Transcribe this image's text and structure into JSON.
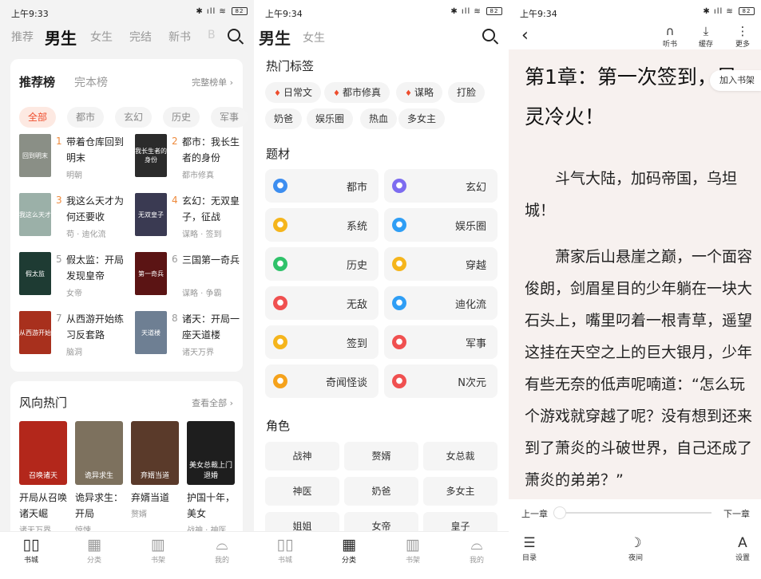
{
  "status": [
    {
      "time": "上午9:33",
      "battery": "82"
    },
    {
      "time": "上午9:34",
      "battery": "82"
    },
    {
      "time": "上午9:34",
      "battery": "82"
    }
  ],
  "p1": {
    "tabs": [
      "推荐",
      "男生",
      "女生",
      "完结",
      "新书",
      "B"
    ],
    "active_tab": "男生",
    "rank": {
      "title": "推荐榜",
      "subtitle": "完本榜",
      "more": "完整榜单 ›",
      "chips": [
        "全部",
        "都市",
        "玄幻",
        "历史",
        "军事"
      ],
      "books": [
        {
          "num": "1",
          "title": "带着仓库回到明末",
          "author": "明朝",
          "cover_text": "回到明末",
          "color": "#8a8f86"
        },
        {
          "num": "2",
          "title": "都市：我长生者的身份",
          "author": "都市修真",
          "cover_text": "我长生者的身份",
          "color": "#2b2b2b"
        },
        {
          "num": "3",
          "title": "我这么天才为何还要收",
          "author": "苟 · 迪化流",
          "cover_text": "我这么天才",
          "color": "#9bb0a8"
        },
        {
          "num": "4",
          "title": "玄幻：无双皇子，征战",
          "author": "谋略 · 签到",
          "cover_text": "无双皇子",
          "color": "#3a3a52"
        },
        {
          "num": "5",
          "title": "假太监：开局发现皇帝",
          "author": "女帝",
          "cover_text": "假太监",
          "color": "#1e3b33"
        },
        {
          "num": "6",
          "title": "三国第一奇兵",
          "author": "谋略 · 争霸",
          "cover_text": "第一奇兵",
          "color": "#5b1414"
        },
        {
          "num": "7",
          "title": "从西游开始练习反套路",
          "author": "脑洞",
          "cover_text": "从西游开始",
          "color": "#a8301d"
        },
        {
          "num": "8",
          "title": "诸天：开局一座天道楼",
          "author": "诸天万界",
          "cover_text": "天道楼",
          "color": "#6e7f93"
        }
      ]
    },
    "hot": {
      "title": "风向热门",
      "more": "查看全部 ›",
      "books": [
        {
          "title": "开局从召唤诸天崛",
          "author": "诸天万界",
          "cover_text": "召唤诸天",
          "color": "#b3271b"
        },
        {
          "title": "诡异求生：开局",
          "author": "惊悚",
          "cover_text": "诡异求生",
          "color": "#7d715e"
        },
        {
          "title": "弃婿当道",
          "author": "赘婿",
          "cover_text": "弃婿当道",
          "color": "#5a3a2a"
        },
        {
          "title": "护国十年，美女",
          "author": "战神 · 神医",
          "cover_text": "美女总裁上门退婚",
          "color": "#1e1e1e"
        }
      ]
    }
  },
  "p2": {
    "tabs": [
      "男生",
      "女生"
    ],
    "hot_tags_title": "热门标签",
    "hot_tags": [
      "日常文",
      "都市修真",
      "谋略",
      "打脸",
      "奶爸",
      "娱乐圈",
      "热血",
      "多女主"
    ],
    "genre_title": "题材",
    "genres": [
      {
        "label": "都市",
        "color": "#3d8ef0"
      },
      {
        "label": "玄幻",
        "color": "#7d6cf0"
      },
      {
        "label": "系统",
        "color": "#f5b51c"
      },
      {
        "label": "娱乐圈",
        "color": "#2f9ef5"
      },
      {
        "label": "历史",
        "color": "#2fc26a"
      },
      {
        "label": "穿越",
        "color": "#f5b51c"
      },
      {
        "label": "无敌",
        "color": "#f05050"
      },
      {
        "label": "迪化流",
        "color": "#2f9ef5"
      },
      {
        "label": "签到",
        "color": "#f5b51c"
      },
      {
        "label": "军事",
        "color": "#f05050"
      },
      {
        "label": "奇闻怪谈",
        "color": "#f5a21c"
      },
      {
        "label": "N次元",
        "color": "#f05050"
      }
    ],
    "role_title": "角色",
    "roles": [
      "战神",
      "赘婿",
      "女总裁",
      "神医",
      "奶爸",
      "多女主",
      "姐姐",
      "女帝",
      "皇子"
    ]
  },
  "p3": {
    "head_actions": [
      {
        "label": "听书",
        "icon": "headphones-icon"
      },
      {
        "label": "缓存",
        "icon": "download-icon"
      },
      {
        "label": "更多",
        "icon": "more-icon"
      }
    ],
    "chapter_title": "第1章：第一次签到，异灵冷火！",
    "shelf_btn": "加入书架",
    "paragraphs": [
      "斗气大陆，加码帝国，乌坦城！",
      "萧家后山悬崖之巅，一个面容俊朗，剑眉星目的少年躺在一块大石头上，嘴里叼着一根青草，遥望这挂在天空之上的巨大银月，少年有些无奈的低声呢喃道：“怎么玩个游戏就穿越了呢？没有想到还来到了萧炎的斗破世界，自己还成了萧炎的弟弟？”"
    ],
    "prev": "上一章",
    "next": "下一章",
    "progress": 0,
    "footer": [
      {
        "label": "目录",
        "icon": "list-icon"
      },
      {
        "label": "夜间",
        "icon": "moon-icon"
      },
      {
        "label": "设置",
        "icon": "font-icon"
      }
    ]
  },
  "nav": [
    {
      "label": "书城",
      "icon": "book-icon"
    },
    {
      "label": "分类",
      "icon": "grid-icon"
    },
    {
      "label": "书架",
      "icon": "shelf-icon"
    },
    {
      "label": "我的",
      "icon": "user-icon"
    }
  ]
}
